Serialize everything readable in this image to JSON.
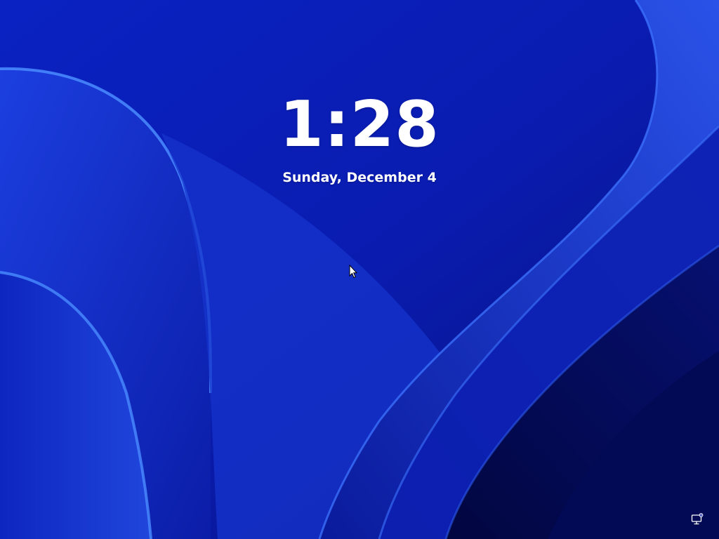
{
  "lock_screen": {
    "time": "1:28",
    "date": "Sunday, December 4"
  },
  "icons": {
    "network": "network-computer-icon",
    "cursor": "mouse-pointer-icon"
  },
  "colors": {
    "background": "#0a1ea8",
    "text": "#ffffff",
    "ribbon_highlight": "#4a8cff"
  }
}
